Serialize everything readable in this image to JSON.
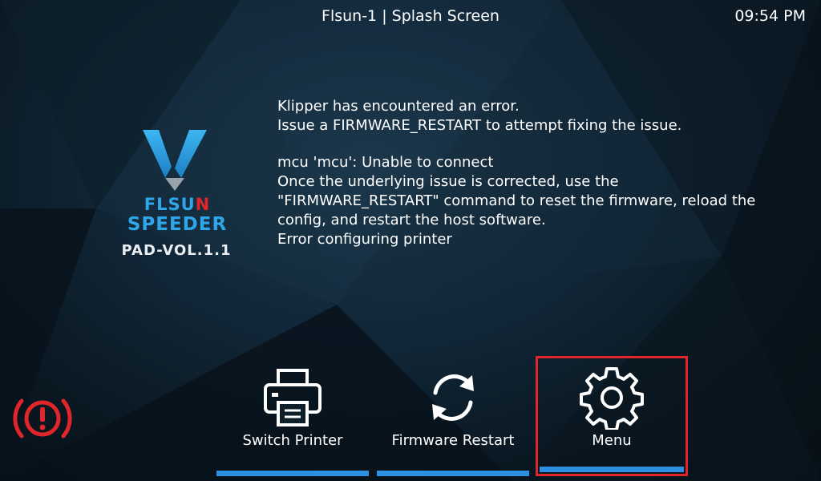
{
  "topbar": {
    "title": "Flsun-1 | Splash Screen",
    "time": "09:54 PM"
  },
  "logo": {
    "brand_main": "FLSU",
    "brand_accent": "N",
    "model": "SPEEDER",
    "version": "PAD-VOL.1.1"
  },
  "message": {
    "lines_1": [
      "Klipper has encountered an error.",
      "Issue a FIRMWARE_RESTART to attempt fixing the issue."
    ],
    "lines_2": [
      "mcu 'mcu': Unable to connect",
      "Once the underlying issue is corrected, use the",
      "\"FIRMWARE_RESTART\" command to reset the firmware, reload the",
      "config, and restart the host software.",
      "Error configuring printer"
    ]
  },
  "buttons": {
    "switch_printer": {
      "label": "Switch Printer",
      "icon": "printer-icon"
    },
    "firmware_restart": {
      "label": "Firmware Restart",
      "icon": "refresh-icon"
    },
    "menu": {
      "label": "Menu",
      "icon": "gear-icon"
    }
  },
  "alert": {
    "icon": "error-alert-icon"
  },
  "colors": {
    "accent_blue": "#2b8fe2",
    "logo_blue": "#2ea6ea",
    "error_red": "#e0262b",
    "highlight_border": "#e0262b",
    "text": "#ffffff"
  }
}
